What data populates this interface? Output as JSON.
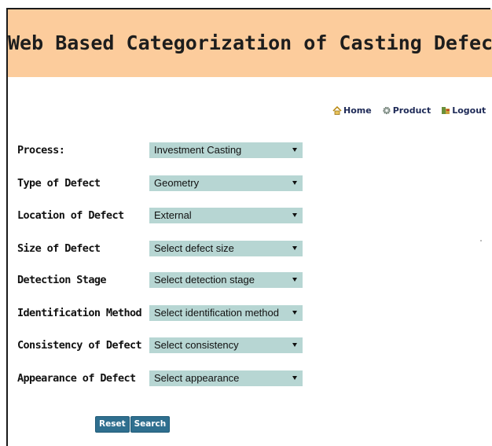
{
  "header": {
    "title": "Web Based Categorization of Casting Defects"
  },
  "nav": {
    "home": "Home",
    "product": "Product",
    "logout": "Logout"
  },
  "form": {
    "fields": [
      {
        "label": "Process:",
        "value": "Investment Casting"
      },
      {
        "label": "Type of Defect",
        "value": "Geometry"
      },
      {
        "label": "Location of Defect",
        "value": "External"
      },
      {
        "label": "Size of Defect",
        "value": "Select defect size"
      },
      {
        "label": "Detection Stage",
        "value": "Select detection stage"
      },
      {
        "label": "Identification Method",
        "value": "Select identification method"
      },
      {
        "label": "Consistency of Defect",
        "value": "Select consistency"
      },
      {
        "label": "Appearance of Defect",
        "value": "Select appearance"
      }
    ],
    "reset_label": "Reset",
    "search_label": "Search"
  },
  "colors": {
    "banner": "#fccc9c",
    "select_bg": "#b7d6d3",
    "button_bg": "#2f6f8f"
  }
}
